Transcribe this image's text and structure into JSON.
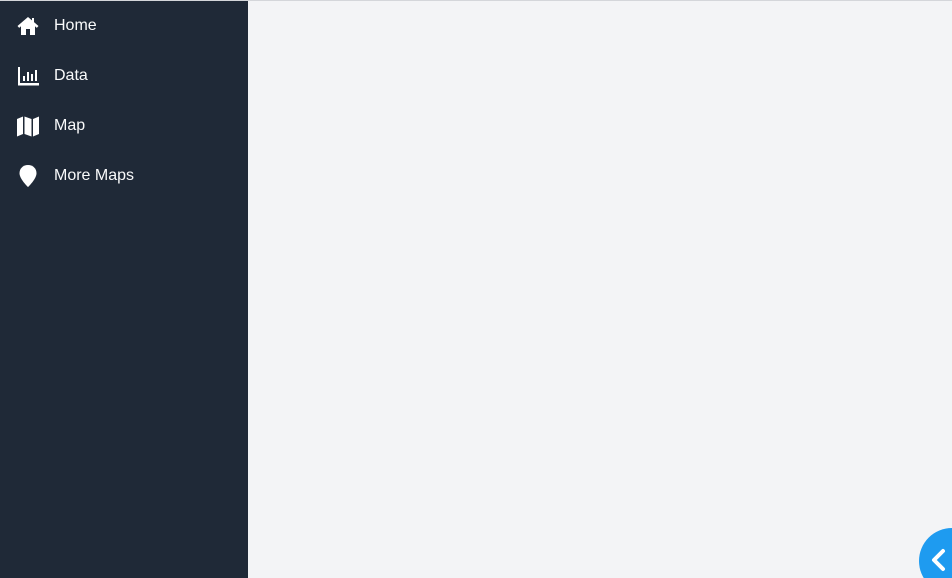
{
  "sidebar": {
    "items": [
      {
        "label": "Home",
        "icon": "home-icon"
      },
      {
        "label": "Data",
        "icon": "bar-chart-icon"
      },
      {
        "label": "Map",
        "icon": "map-icon"
      },
      {
        "label": "More Maps",
        "icon": "map-pin-icon"
      }
    ]
  },
  "collapse_button": {
    "icon": "chevron-left-icon"
  },
  "colors": {
    "sidebar_bg": "#1f2937",
    "main_bg": "#f3f4f6",
    "accent": "#1e9bf0",
    "text": "#ffffff"
  }
}
